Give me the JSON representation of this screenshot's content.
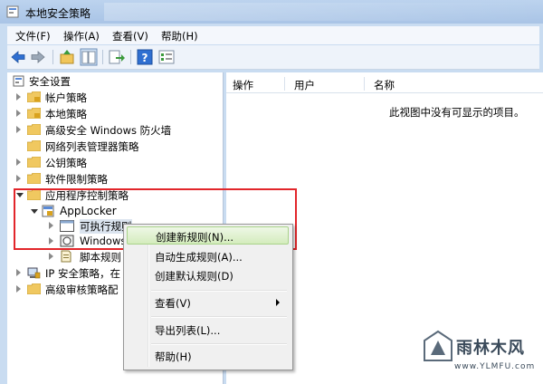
{
  "window": {
    "title": "本地安全策略"
  },
  "menu": [
    "文件(F)",
    "操作(A)",
    "查看(V)",
    "帮助(H)"
  ],
  "toolbar": [
    "back-icon",
    "forward-icon",
    "up-icon",
    "show-hide-tree-icon",
    "export-icon",
    "help-icon",
    "properties-icon"
  ],
  "tree": {
    "root": "安全设置",
    "items": [
      "帐户策略",
      "本地策略",
      "高级安全 Windows 防火墙",
      "网络列表管理器策略",
      "公钥策略",
      "软件限制策略",
      "应用程序控制策略",
      "AppLocker",
      "可执行规则",
      "Windows",
      "脚本规则",
      "IP 安全策略，在",
      "高级审核策略配"
    ]
  },
  "list": {
    "columns": [
      "操作",
      "用户",
      "名称"
    ],
    "empty_message": "此视图中没有可显示的项目。"
  },
  "context_menu": {
    "items": [
      "创建新规则(N)...",
      "自动生成规则(A)...",
      "创建默认规则(D)",
      "查看(V)",
      "导出列表(L)...",
      "帮助(H)"
    ]
  },
  "watermark": {
    "text": "雨林木风",
    "url": "www.YLMFU.com"
  },
  "colors": {
    "highlight_box": "#e2262b",
    "menu_highlight": "#d4ecbd"
  }
}
